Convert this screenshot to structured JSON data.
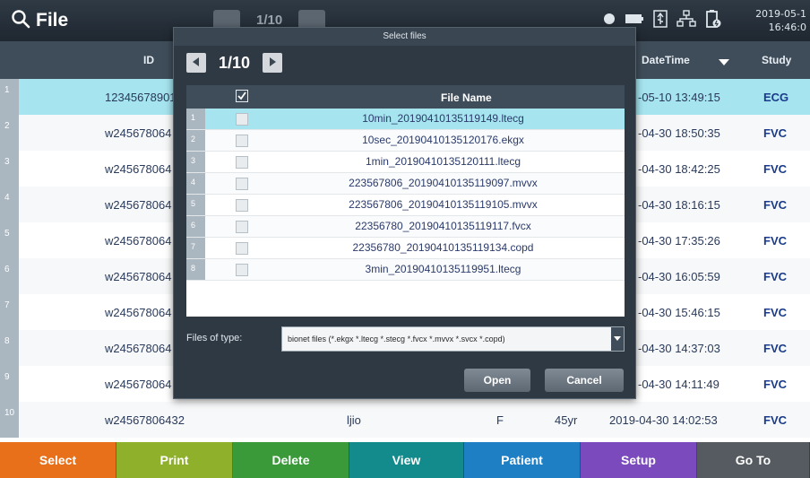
{
  "app": {
    "title": "File",
    "date": "2019-05-1",
    "time": "16:46:0"
  },
  "background_pager": {
    "page": "1/10"
  },
  "table": {
    "headers": {
      "id": "ID",
      "datetime": "DateTime",
      "study": "Study"
    },
    "rows": [
      {
        "idx": "1",
        "id": "12345678901",
        "datetime": "-05-10 13:49:15",
        "study": "ECG"
      },
      {
        "idx": "2",
        "id": "w245678064",
        "datetime": "-04-30 18:50:35",
        "study": "FVC"
      },
      {
        "idx": "3",
        "id": "w245678064",
        "datetime": "-04-30 18:42:25",
        "study": "FVC"
      },
      {
        "idx": "4",
        "id": "w245678064",
        "datetime": "-04-30 18:16:15",
        "study": "FVC"
      },
      {
        "idx": "5",
        "id": "w245678064",
        "datetime": "-04-30 17:35:26",
        "study": "FVC"
      },
      {
        "idx": "6",
        "id": "w245678064",
        "datetime": "-04-30 16:05:59",
        "study": "FVC"
      },
      {
        "idx": "7",
        "id": "w245678064",
        "datetime": "-04-30 15:46:15",
        "study": "FVC"
      },
      {
        "idx": "8",
        "id": "w245678064",
        "datetime": "-04-30 14:37:03",
        "study": "FVC"
      },
      {
        "idx": "9",
        "id": "w245678064",
        "datetime": "-04-30 14:11:49",
        "study": "FVC"
      },
      {
        "idx": "10",
        "id": "w24567806432",
        "name": "ljio",
        "sex": "F",
        "age": "45yr",
        "datetime": "2019-04-30 14:02:53",
        "study": "FVC"
      }
    ]
  },
  "toolbar": [
    {
      "label": "Select",
      "color": "#e8701a"
    },
    {
      "label": "Print",
      "color": "#8fb02a"
    },
    {
      "label": "Delete",
      "color": "#3a9a3a"
    },
    {
      "label": "View",
      "color": "#138a8c"
    },
    {
      "label": "Patient",
      "color": "#1e7fc4"
    },
    {
      "label": "Setup",
      "color": "#7b4bbd"
    },
    {
      "label": "Go To",
      "color": "#555b60"
    }
  ],
  "dialog": {
    "title": "Select files",
    "page": "1/10",
    "column": "File Name",
    "files": [
      {
        "idx": "1",
        "name": "10min_20190410135119149.ltecg"
      },
      {
        "idx": "2",
        "name": "10sec_20190410135120176.ekgx"
      },
      {
        "idx": "3",
        "name": "1min_20190410135120111.ltecg"
      },
      {
        "idx": "4",
        "name": "223567806_20190410135119097.mvvx"
      },
      {
        "idx": "5",
        "name": "223567806_20190410135119105.mvvx"
      },
      {
        "idx": "6",
        "name": "22356780_20190410135119117.fvcx"
      },
      {
        "idx": "7",
        "name": "22356780_20190410135119134.copd"
      },
      {
        "idx": "8",
        "name": "3min_20190410135119951.ltecg"
      }
    ],
    "files_of_type_label": "Files of type:",
    "files_of_type_value": "bionet files (*.ekgx *.ltecg *.stecg *.fvcx *.mvvx *.svcx *.copd)",
    "open_label": "Open",
    "cancel_label": "Cancel"
  }
}
